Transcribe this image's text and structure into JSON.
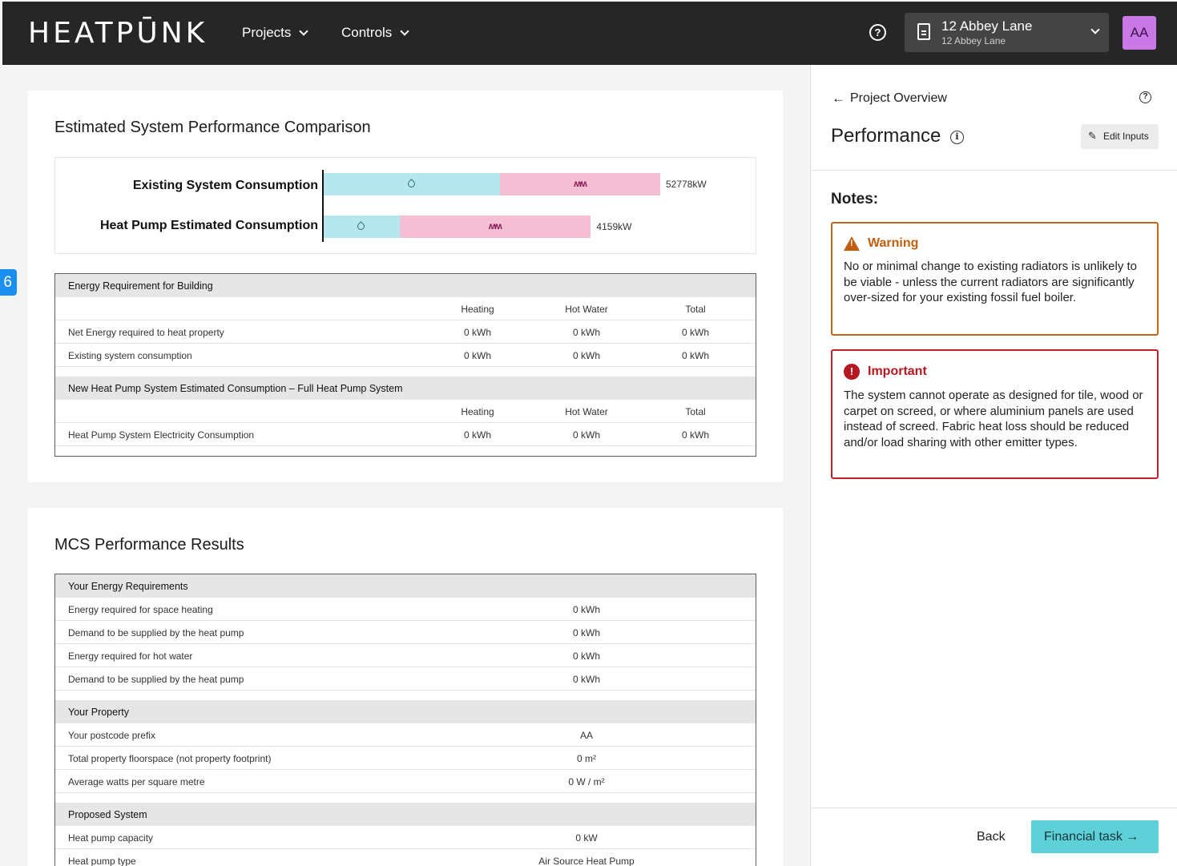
{
  "header": {
    "logo": "HEATPŪNK",
    "menu": [
      {
        "label": "Projects"
      },
      {
        "label": "Controls"
      }
    ],
    "help_glyph": "?",
    "project": {
      "title": "12 Abbey Lane",
      "subtitle": "12 Abbey Lane"
    },
    "avatar": "AA"
  },
  "side_tab": "6",
  "comparison": {
    "title": "Estimated System Performance Comparison",
    "chart_data": {
      "type": "bar",
      "orientation": "horizontal",
      "stacked": true,
      "categories": [
        "Existing System Consumption",
        "Heat Pump Estimated Consumption"
      ],
      "series": [
        {
          "icon": "water-drop-icon",
          "color": "#b6e7ee",
          "values": [
            27700,
            11900
          ]
        },
        {
          "icon": "radiator-icon",
          "color": "#f5bfd3",
          "values": [
            25078,
            30000
          ]
        }
      ],
      "value_labels": [
        "52778kW",
        "4159kW"
      ]
    }
  },
  "energy_table": {
    "section1": "Energy Requirement for Building",
    "columns": [
      "Heating",
      "Hot Water",
      "Total"
    ],
    "rows1": [
      {
        "label": "Net Energy required to heat property",
        "heating": "0 kWh",
        "hot_water": "0 kWh",
        "total": "0 kWh"
      },
      {
        "label": "Existing system consumption",
        "heating": "0 kWh",
        "hot_water": "0 kWh",
        "total": "0 kWh"
      }
    ],
    "section2": "New Heat Pump System Estimated Consumption – Full Heat Pump System",
    "rows2": [
      {
        "label": "Heat Pump System Electricity Consumption",
        "heating": "0 kWh",
        "hot_water": "0 kWh",
        "total": "0 kWh"
      }
    ]
  },
  "mcs": {
    "title": "MCS Performance Results",
    "sections": [
      {
        "heading": "Your Energy Requirements",
        "rows": [
          {
            "label": "Energy required for space heating",
            "value": "0 kWh"
          },
          {
            "label": "Demand to be supplied by the heat pump",
            "value": "0 kWh"
          },
          {
            "label": "Energy required for hot water",
            "value": "0 kWh"
          },
          {
            "label": "Demand to be supplied by the heat pump",
            "value": "0 kWh"
          }
        ]
      },
      {
        "heading": "Your Property",
        "rows": [
          {
            "label": "Your postcode prefix",
            "value": "AA"
          },
          {
            "label": "Total property floorspace (not property footprint)",
            "value": "0 m²"
          },
          {
            "label": "Average watts per square metre",
            "value": "0 W / m²"
          }
        ]
      },
      {
        "heading": "Proposed System",
        "rows": [
          {
            "label": "Heat pump capacity",
            "value": "0 kW"
          },
          {
            "label": "Heat pump type",
            "value": "Air Source Heat Pump"
          }
        ]
      }
    ]
  },
  "panel": {
    "back_link": "Project Overview",
    "help_glyph": "?",
    "title": "Performance",
    "info_glyph": "i",
    "edit_button": "Edit Inputs",
    "notes_title": "Notes:",
    "warning": {
      "title": "Warning",
      "body": "No or minimal change to existing radiators is unlikely to be viable - unless the current radiators are significantly over-sized for your existing fossil fuel boiler."
    },
    "important": {
      "title": "Important",
      "body": "The system cannot operate as designed for tile, wood or carpet on screed, or where aluminium panels are used instead of screed. Fabric heat loss should be reduced and/or load sharing with other emitter types."
    },
    "back_button": "Back",
    "next_button": "Financial task"
  }
}
